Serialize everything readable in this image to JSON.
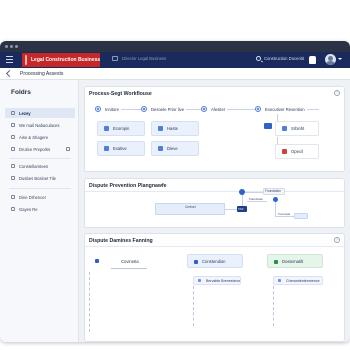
{
  "header": {
    "brand_name": "Legal Construction Business",
    "tab2_label": "Director Legal Business",
    "search_label": "Construction Docentit",
    "colors": {
      "topbar": "#1b2a5c",
      "brand": "#c62828",
      "accent": "#4f7fdc"
    },
    "icons": [
      "menu-icon",
      "logo-icon",
      "folder-icon",
      "search-icon",
      "bell-icon",
      "avatar",
      "chevron-down-icon"
    ]
  },
  "breadcrumb": {
    "label": "Processing Assests"
  },
  "sidebar": {
    "title": "Foldrs",
    "items": [
      {
        "label": "Lezey",
        "active": true
      },
      {
        "label": "We mail Nabaculaces",
        "active": false
      },
      {
        "label": "Aise & Shagere",
        "active": false
      },
      {
        "label": "Drutice Preporks",
        "active": false,
        "badge": true
      },
      {
        "label": "Constellarntees",
        "active": false
      },
      {
        "label": "Dusbes Bosinet Tile",
        "active": false
      },
      {
        "label": "Dine Drhencer",
        "active": false
      },
      {
        "label": "Gayes Re",
        "active": false
      }
    ]
  },
  "workflow": {
    "title": "Process-Segt Workflouse",
    "steps": [
      "Innitore",
      "Desoete Prior live",
      "Afesiter",
      "Executiver Revention"
    ],
    "tiles": [
      "Ecompin",
      "Haste",
      "Exative",
      "Dieve"
    ],
    "right_tiles": [
      "Srbinht",
      "Opecil"
    ]
  },
  "dispute_prevention": {
    "title": "Dispute Prevention Plangnawfe",
    "labels": [
      "Cerbort",
      "Tsaretriade",
      "TAX",
      "Foundation",
      "Tuvontele"
    ]
  },
  "dispute_planning": {
    "title": "Dispute Damines Fanning",
    "columns": [
      {
        "head": "Covinetta",
        "rows": []
      },
      {
        "head": "Constendion",
        "rows": [
          "Bervable Brenesteror"
        ]
      },
      {
        "head": "Dosternatilt",
        "rows": [
          "Cherandentenmence"
        ]
      }
    ]
  }
}
